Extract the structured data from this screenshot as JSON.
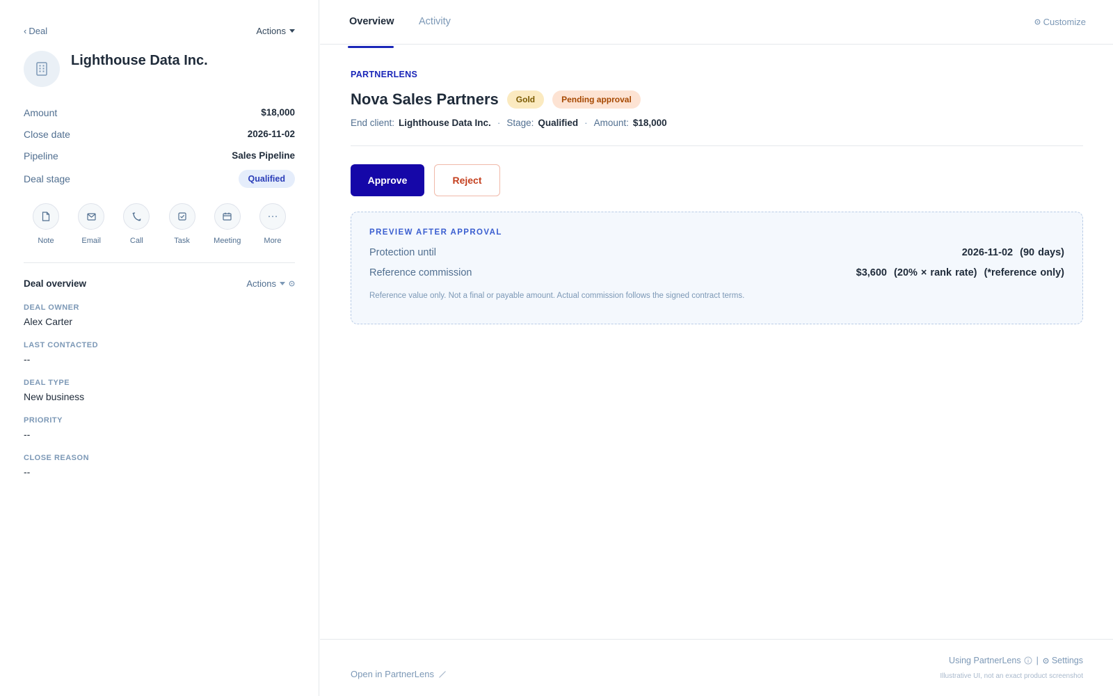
{
  "sidebar": {
    "back_label": "Deal",
    "actions_label": "Actions",
    "company_name": "Lighthouse Data Inc.",
    "properties": [
      {
        "label": "Amount",
        "value": "$18,000"
      },
      {
        "label": "Close date",
        "value": "2026-11-02"
      },
      {
        "label": "Pipeline",
        "value": "Sales Pipeline"
      }
    ],
    "deal_stage": {
      "label": "Deal stage",
      "value": "Qualified"
    },
    "quick_actions": [
      {
        "label": "Note",
        "icon": "note-icon"
      },
      {
        "label": "Email",
        "icon": "email-icon"
      },
      {
        "label": "Call",
        "icon": "call-icon"
      },
      {
        "label": "Task",
        "icon": "task-icon"
      },
      {
        "label": "Meeting",
        "icon": "meeting-icon"
      },
      {
        "label": "More",
        "icon": "more-icon"
      }
    ],
    "overview": {
      "title": "Deal overview",
      "actions_label": "Actions",
      "fields": [
        {
          "label": "DEAL OWNER",
          "value": "Alex Carter"
        },
        {
          "label": "LAST CONTACTED",
          "value": "--"
        },
        {
          "label": "DEAL TYPE",
          "value": "New business"
        },
        {
          "label": "PRIORITY",
          "value": "--"
        },
        {
          "label": "CLOSE REASON",
          "value": "--"
        }
      ]
    }
  },
  "main": {
    "tabs": [
      {
        "label": "Overview",
        "active": true
      },
      {
        "label": "Activity",
        "active": false
      }
    ],
    "customize_label": "Customize",
    "app_label": "PARTNERLENS",
    "partner_name": "Nova Sales Partners",
    "badges": {
      "tier": "Gold",
      "status": "Pending approval"
    },
    "meta": {
      "end_client_label": "End client:",
      "end_client_value": "Lighthouse Data Inc.",
      "stage_label": "Stage:",
      "stage_value": "Qualified",
      "amount_label": "Amount:",
      "amount_value": "$18,000",
      "separator": "·"
    },
    "buttons": {
      "approve": "Approve",
      "reject": "Reject"
    },
    "preview": {
      "title": "PREVIEW AFTER APPROVAL",
      "rows": [
        {
          "label": "Protection until",
          "value": "2026-11-02  (90 days)"
        },
        {
          "label": "Reference commission",
          "value": "$3,600  (20% × rank rate)  (*reference only)"
        }
      ],
      "note": "Reference value only. Not a final or payable amount. Actual commission follows the signed contract terms."
    },
    "footer": {
      "open_link": "Open in PartnerLens",
      "using_label": "Using PartnerLens",
      "separator": "|",
      "settings_label": "Settings",
      "disclaimer": "Illustrative UI, not an exact product screenshot"
    }
  },
  "colors": {
    "accent": "#1507a8",
    "link_blue": "#1a26b8",
    "stage_pill_bg": "#e5edfb",
    "gold_bg": "#fbeac0",
    "pending_bg": "#fde3d3",
    "reject_text": "#c4401f",
    "preview_bg": "#f4f8fd"
  }
}
